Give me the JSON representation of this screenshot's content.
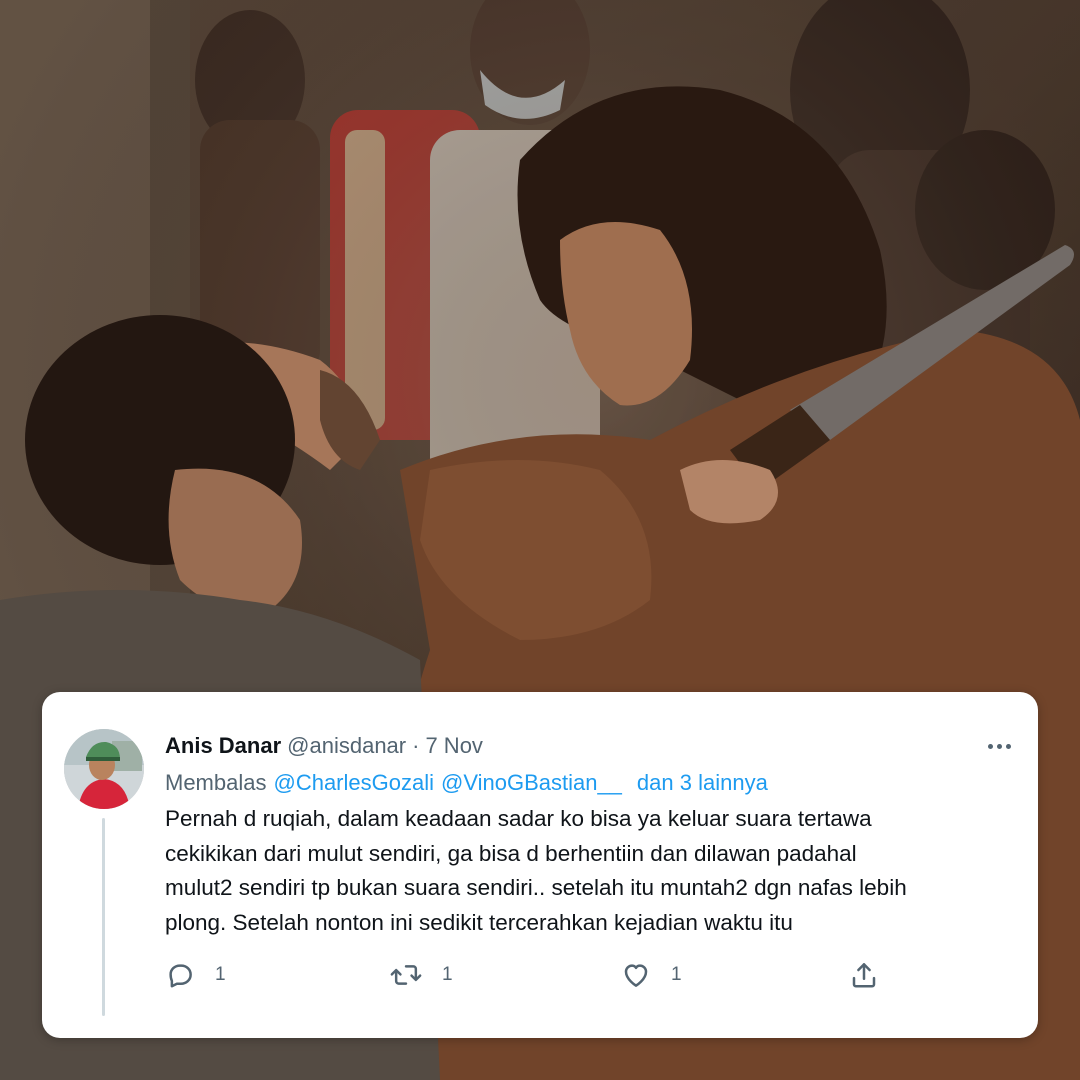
{
  "tweet": {
    "display_name": "Anis Danar",
    "handle": "@anisdanar",
    "separator": "·",
    "date": "7 Nov",
    "reply_prefix": "Membalas",
    "mentions": [
      "@CharlesGozali",
      "@VinoGBastian__"
    ],
    "others": "dan 3 lainnya",
    "text_lines": [
      "Pernah d ruqiah, dalam keadaan sadar ko bisa ya keluar suara tertawa",
      "cekikikan dari mulut sendiri, ga bisa d berhentiin dan dilawan padahal",
      "mulut2 sendiri tp bukan suara sendiri.. setelah itu muntah2 dgn nafas lebih",
      "plong. Setelah nonton ini sedikit tercerahkan kejadian waktu itu"
    ],
    "actions": {
      "reply_icon": "reply-icon",
      "reply_count": "1",
      "retweet_icon": "retweet-icon",
      "retweet_count": "1",
      "like_icon": "heart-icon",
      "like_count": "1",
      "share_icon": "share-icon"
    }
  },
  "colors": {
    "accent": "#1d9bf0",
    "text_primary": "#0f1419",
    "text_secondary": "#536471",
    "card_background": "#ffffff"
  }
}
